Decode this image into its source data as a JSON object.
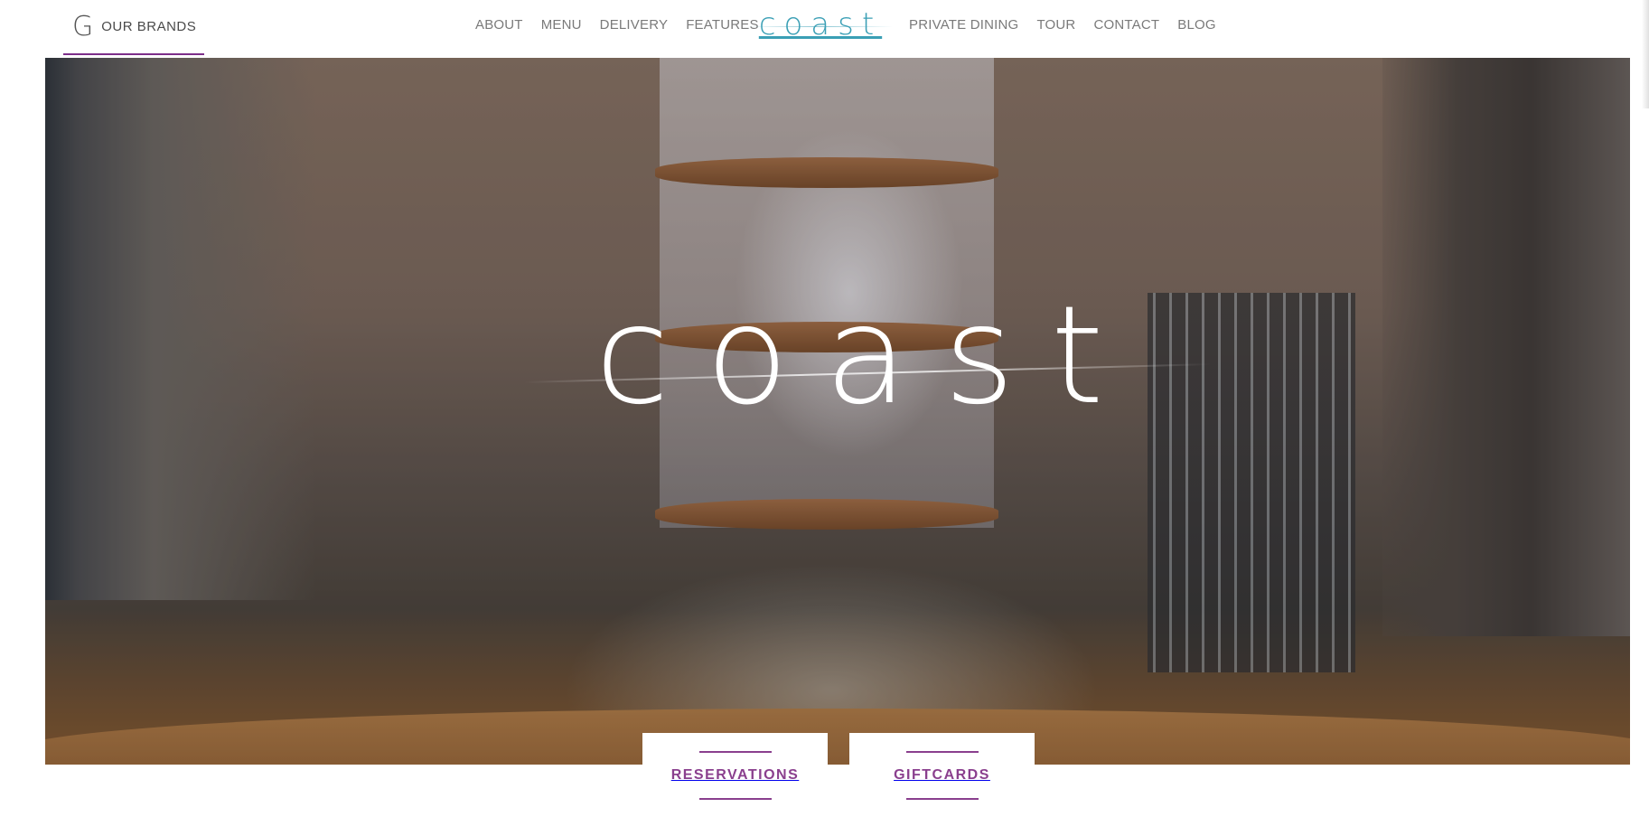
{
  "header": {
    "brands_icon_letter": "G",
    "brands_label": "OUR BRANDS",
    "nav_left": [
      "ABOUT",
      "MENU",
      "DELIVERY",
      "FEATURES"
    ],
    "logo": "coast",
    "nav_right": [
      "PRIVATE DINING",
      "TOUR",
      "CONTACT",
      "BLOG"
    ]
  },
  "hero": {
    "logo": "coast"
  },
  "actions": {
    "reservations": "RESERVATIONS",
    "giftcards": "GIFTCARDS"
  },
  "colors": {
    "accent_purple": "#8a3f8e",
    "logo_teal": "#3a9fb5",
    "nav_gray": "#7a7a7a"
  }
}
